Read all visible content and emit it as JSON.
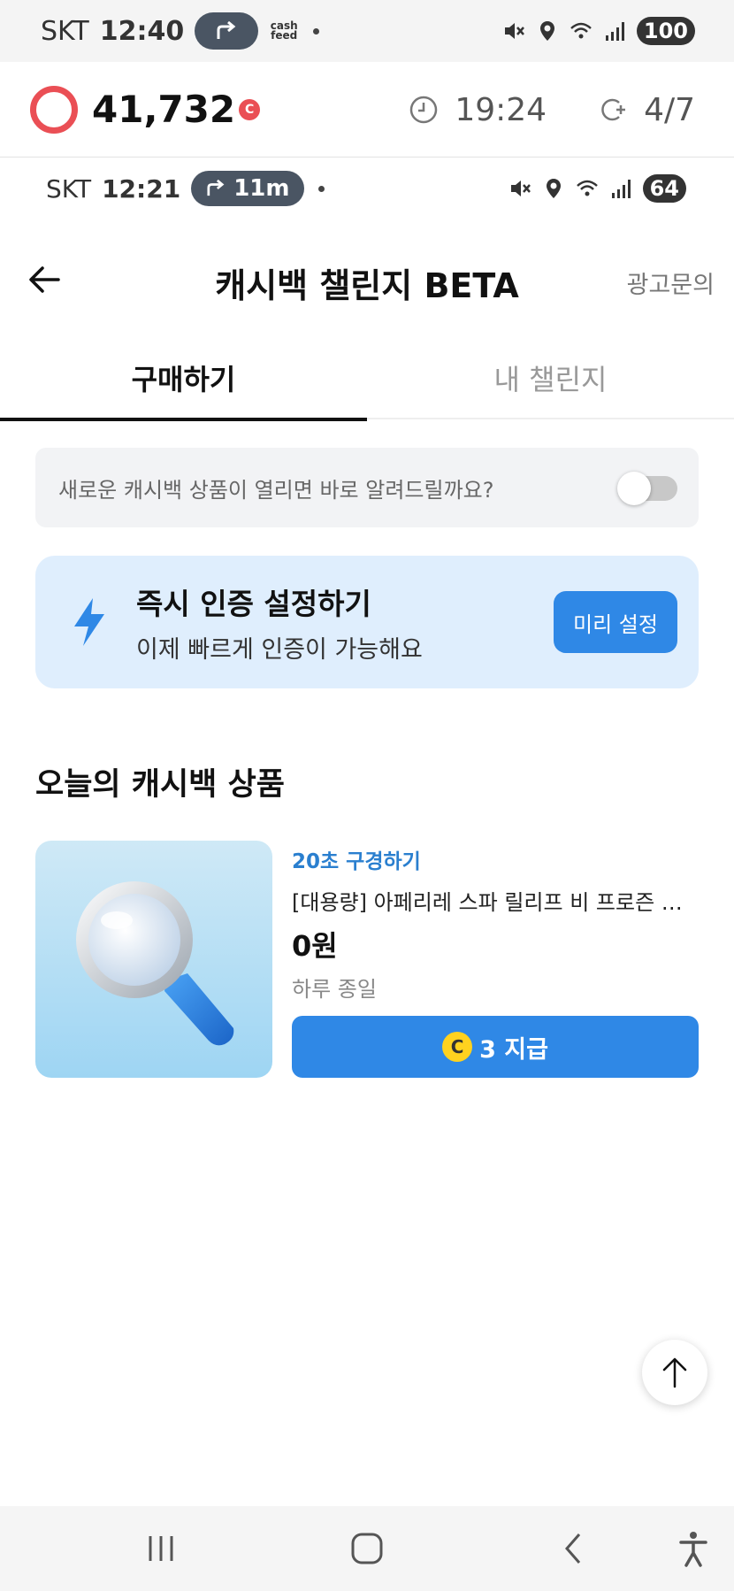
{
  "outer_status": {
    "carrier": "SKT",
    "time": "12:40",
    "app_label_top": "cash",
    "app_label_bottom": "feed",
    "battery": "100"
  },
  "points_bar": {
    "points": "41,732",
    "coin_symbol": "C",
    "timer": "19:24",
    "count": "4/7"
  },
  "inner_status": {
    "carrier": "SKT",
    "time": "12:21",
    "pill_text": "11m",
    "battery": "64"
  },
  "header": {
    "title": "캐시백 챌린지 BETA",
    "ad_inquiry": "광고문의"
  },
  "tabs": [
    {
      "label": "구매하기",
      "active": true
    },
    {
      "label": "내 챌린지",
      "active": false
    }
  ],
  "notify": {
    "text": "새로운 캐시백 상품이 열리면 바로 알려드릴까요?",
    "enabled": false
  },
  "instant_auth": {
    "title": "즉시 인증 설정하기",
    "subtitle": "이제 빠르게 인증이 가능해요",
    "button": "미리 설정"
  },
  "section": {
    "title": "오늘의 캐시백 상품"
  },
  "product": {
    "tag": "20초 구경하기",
    "name": "[대용량] 아페리레 스파 릴리프 비 프로즌 빙하…",
    "price": "0원",
    "period": "하루 종일",
    "reward_coin": "C",
    "reward_text": "3 지급"
  },
  "colors": {
    "accent_blue": "#2f88e6",
    "ring_red": "#ea4f55",
    "card_bg": "#dfeefd",
    "coin_yellow": "#ffd21f"
  }
}
